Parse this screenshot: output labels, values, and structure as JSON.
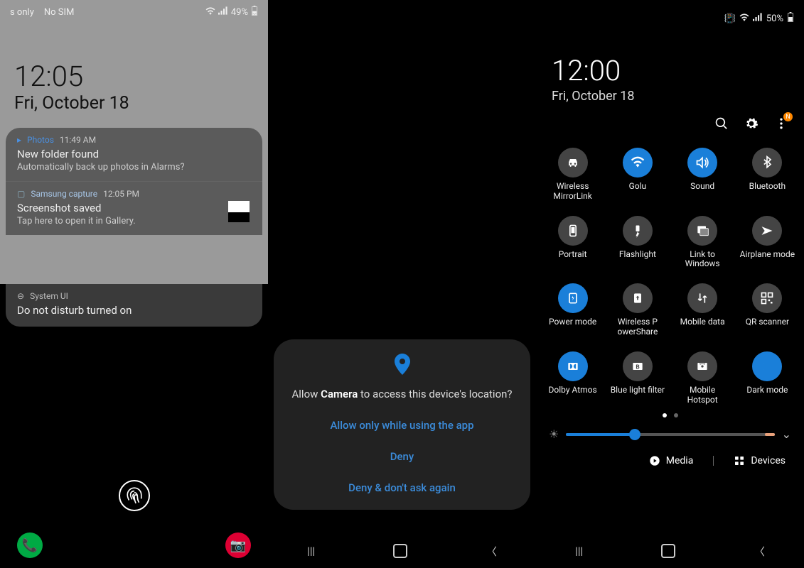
{
  "screen1": {
    "status": {
      "left1": "s only",
      "left2": "No SIM",
      "batt": "49%"
    },
    "clock": {
      "time": "12:05",
      "date": "Fri, October 18"
    },
    "notif1": {
      "app": "Photos",
      "time": "11:49 AM",
      "title": "New folder found",
      "body": "Automatically back up photos in Alarms?"
    },
    "notif2": {
      "app": "Samsung capture",
      "time": "12:05 PM",
      "title": "Screenshot saved",
      "body": "Tap here to open it in Gallery."
    },
    "notif3": {
      "app": "System UI",
      "title": "Do not disturb turned on"
    }
  },
  "screen2": {
    "dialog": {
      "msg_pre": "Allow ",
      "msg_app": "Camera",
      "msg_post": " to access this device's location?",
      "opt1": "Allow only while using the app",
      "opt2": "Deny",
      "opt3": "Deny & don't ask again"
    }
  },
  "screen3": {
    "status": {
      "batt": "50%"
    },
    "clock": {
      "time": "12:00",
      "date": "Fri, October 18"
    },
    "badge": "N",
    "toggles": [
      {
        "name": "wireless-mirrorlink",
        "label": "Wireless MirrorLink",
        "on": false,
        "icon": "car"
      },
      {
        "name": "wifi",
        "label": "Golu",
        "on": true,
        "icon": "wifi"
      },
      {
        "name": "sound",
        "label": "Sound",
        "on": true,
        "icon": "sound"
      },
      {
        "name": "bluetooth",
        "label": "Bluetooth",
        "on": false,
        "icon": "bt"
      },
      {
        "name": "portrait",
        "label": "Portrait",
        "on": false,
        "icon": "portrait"
      },
      {
        "name": "flashlight",
        "label": "Flashlight",
        "on": false,
        "icon": "flash"
      },
      {
        "name": "link-windows",
        "label": "Link to Windows",
        "on": false,
        "icon": "link"
      },
      {
        "name": "airplane",
        "label": "Airplane mode",
        "on": false,
        "icon": "air"
      },
      {
        "name": "power-mode",
        "label": "Power mode",
        "on": true,
        "icon": "power"
      },
      {
        "name": "powerShare",
        "label": "Wireless P owerShare",
        "on": false,
        "icon": "share"
      },
      {
        "name": "mobile-data",
        "label": "Mobile data",
        "on": false,
        "icon": "data"
      },
      {
        "name": "qr",
        "label": "QR scanner",
        "on": false,
        "icon": "qr"
      },
      {
        "name": "dolby",
        "label": "Dolby Atmos",
        "on": true,
        "icon": "dolby"
      },
      {
        "name": "bluelight",
        "label": "Blue light filter",
        "on": false,
        "icon": "blue"
      },
      {
        "name": "hotspot",
        "label": "Mobile Hotspot",
        "on": false,
        "icon": "hotspot"
      },
      {
        "name": "dark",
        "label": "Dark mode",
        "on": true,
        "icon": "dark"
      }
    ],
    "brightness": 33,
    "bottom": {
      "media": "Media",
      "devices": "Devices"
    }
  }
}
